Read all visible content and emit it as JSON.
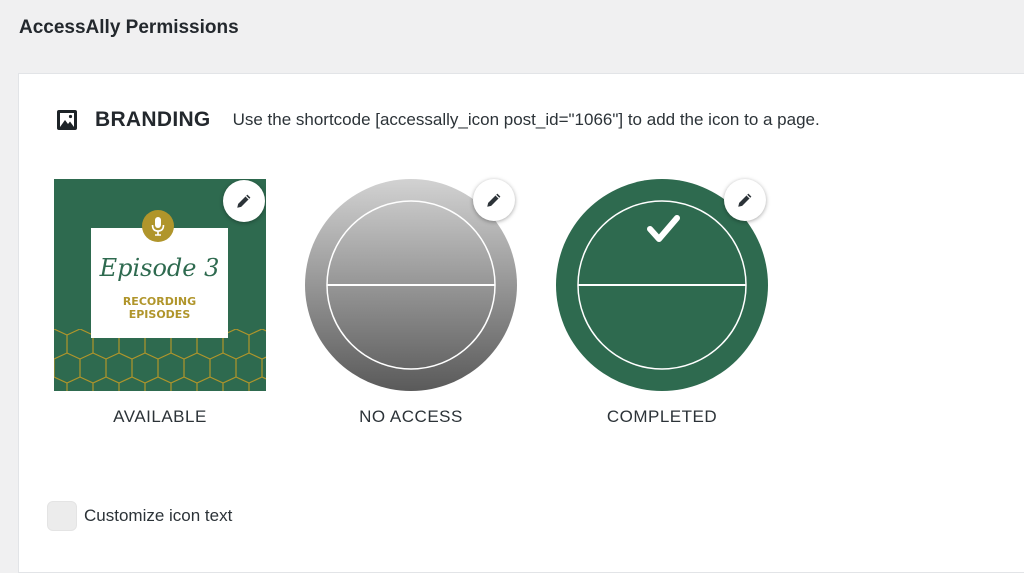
{
  "header": {
    "title": "AccessAlly Permissions"
  },
  "branding": {
    "icon": "image-icon",
    "title": "BRANDING",
    "shortcode_text": "Use the shortcode [accessally_icon post_id=\"1066\"] to add the icon to a page."
  },
  "icons": [
    {
      "label": "AVAILABLE",
      "thumbnail": {
        "script_title": "Episode 3",
        "subtitle_line1": "RECORDING",
        "subtitle_line2": "EPISODES"
      },
      "edit_icon": "pencil-icon"
    },
    {
      "label": "NO ACCESS",
      "edit_icon": "pencil-icon"
    },
    {
      "label": "COMPLETED",
      "check_icon": "checkmark-icon",
      "edit_icon": "pencil-icon"
    }
  ],
  "customize": {
    "label": "Customize icon text",
    "checked": false
  },
  "colors": {
    "brand_green": "#2e6a4f",
    "gold": "#b0952b",
    "grey_light": "#cfcfcf",
    "grey_dark": "#5e5e5e"
  }
}
